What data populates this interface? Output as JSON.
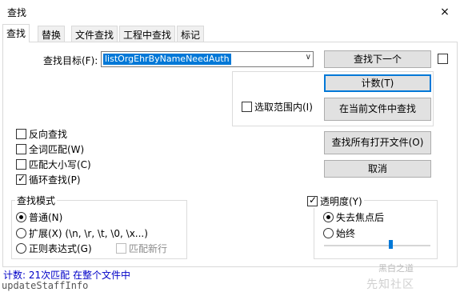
{
  "window": {
    "title": "查找",
    "close_glyph": "×"
  },
  "tabs": [
    "查找",
    "替换",
    "文件查找",
    "工程中查找",
    "标记"
  ],
  "find": {
    "label": "查找目标(F):",
    "value": "listOrgEhrByNameNeedAuth",
    "dropdown_glyph": "∨"
  },
  "buttons": {
    "find_next": "查找下一个",
    "count": "计数(T)",
    "find_in_current": "在当前文件中查找",
    "find_in_all_open": "查找所有打开文件(O)",
    "cancel": "取消"
  },
  "selection_scope": {
    "label": "选取范围内(I)",
    "checked": false
  },
  "options": [
    {
      "label": "反向查找",
      "checked": false
    },
    {
      "label": "全词匹配(W)",
      "checked": false
    },
    {
      "label": "匹配大小写(C)",
      "checked": false
    },
    {
      "label": "循环查找(P)",
      "checked": true
    }
  ],
  "search_mode": {
    "title": "查找模式",
    "options": [
      {
        "label": "普通(N)",
        "selected": true
      },
      {
        "label": "扩展(X) (\\n, \\r, \\t, \\0, \\x...)",
        "selected": false
      },
      {
        "label": "正则表达式(G)",
        "selected": false
      }
    ],
    "match_newline": {
      "label": "匹配新行",
      "checked": false,
      "enabled": false
    }
  },
  "transparency": {
    "label": "透明度(Y)",
    "checked": true,
    "options": [
      {
        "label": "失去焦点后",
        "selected": true
      },
      {
        "label": "始终",
        "selected": false
      }
    ],
    "level": 0.62
  },
  "status": {
    "text": "计数: 21次匹配 在整个文件中"
  },
  "background_text": "updateStaffInfo",
  "watermark": {
    "line1": "黑白之道",
    "line2": "先知社区"
  },
  "colors": {
    "accent": "#0078d7",
    "status_text": "#0000c8",
    "selection": "#0078d7"
  }
}
